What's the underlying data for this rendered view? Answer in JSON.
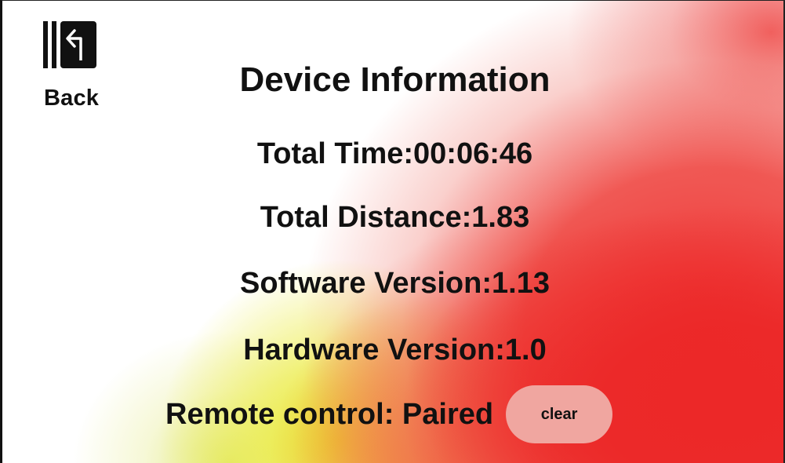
{
  "header": {
    "back_label": "Back",
    "back_icon": "exit-arrow-icon",
    "title": "Device Information"
  },
  "info": {
    "total_time": "Total Time:00:06:46",
    "total_distance": "Total Distance:1.83",
    "software_version": "Software Version:1.13",
    "hardware_version": "Hardware Version:1.0"
  },
  "remote": {
    "label": "Remote control: Paired",
    "clear_label": "clear"
  },
  "colors": {
    "text": "#111111",
    "clear_button_bg": "#f0a6a0",
    "gradient_red": "#ec2828",
    "gradient_yellow": "#e8e828",
    "gradient_orange": "#f09628"
  }
}
